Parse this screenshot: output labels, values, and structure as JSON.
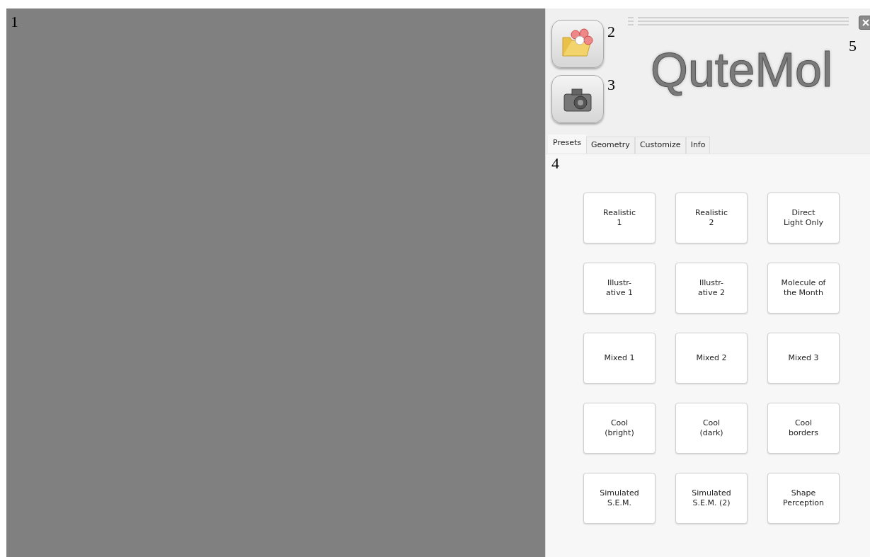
{
  "viewport": {
    "callout": "1"
  },
  "toolbar": {
    "buttons": [
      {
        "kind": "open",
        "callout": "2"
      },
      {
        "kind": "snapshot",
        "callout": "3"
      }
    ],
    "close_callout": "5"
  },
  "logo": "QuteMol",
  "tabs": [
    {
      "label": "Presets",
      "selected": true
    },
    {
      "label": "Geometry",
      "selected": false
    },
    {
      "label": "Customize",
      "selected": false
    },
    {
      "label": "Info",
      "selected": false
    }
  ],
  "tabs_callout": "4",
  "presets": [
    "Realistic\n1",
    "Realistic\n2",
    "Direct\nLight Only",
    "Illustr-\native 1",
    "Illustr-\native 2",
    "Molecule of\nthe Month",
    "Mixed 1",
    "Mixed 2",
    "Mixed 3",
    "Cool\n(bright)",
    "Cool\n(dark)",
    "Cool\nborders",
    "Simulated\nS.E.M.",
    "Simulated\nS.E.M. (2)",
    "Shape\nPerception"
  ]
}
